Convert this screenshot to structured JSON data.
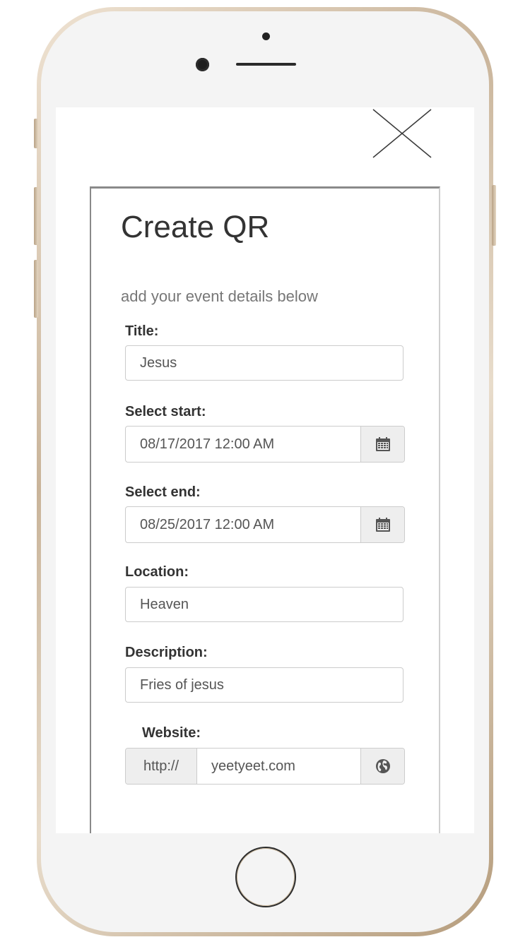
{
  "form": {
    "heading": "Create QR",
    "subheading": "add your event details below",
    "title_label": "Title:",
    "title_value": "Jesus",
    "start_label": "Select start:",
    "start_value": "08/17/2017 12:00 AM",
    "end_label": "Select end:",
    "end_value": "08/25/2017 12:00 AM",
    "location_label": "Location:",
    "location_value": "Heaven",
    "description_label": "Description:",
    "description_value": "Fries of jesus",
    "website_label": "Website:",
    "website_prefix": "http://",
    "website_value": "yeetyeet.com"
  },
  "icons": {
    "close": "close-icon",
    "calendar": "calendar-icon",
    "globe": "globe-icon"
  },
  "colors": {
    "phone_frame": "#d8c6ad",
    "addon_bg": "#eeeeee",
    "text": "#333333"
  }
}
